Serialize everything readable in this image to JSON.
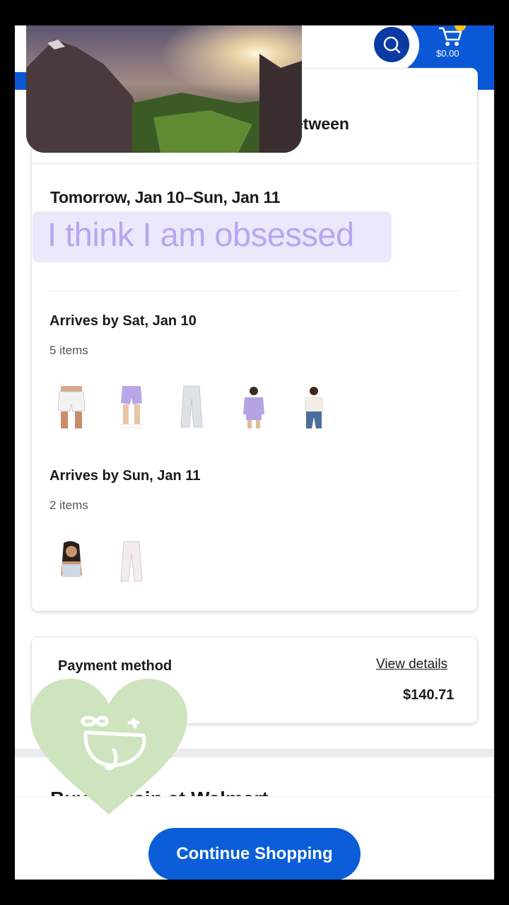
{
  "header": {
    "cart_total": "$0.00",
    "search_icon": "search-icon",
    "cart_icon": "cart-icon",
    "brand_color": "#0b5ed7"
  },
  "delivery": {
    "heading_partial": "etween",
    "date_range": "Tomorrow, Jan 10–Sun, Jan 11",
    "groups": [
      {
        "title": "Arrives by Sat, Jan 10",
        "count": "5 items"
      },
      {
        "title": "Arrives by Sun, Jan 11",
        "count": "2 items"
      }
    ]
  },
  "overlay": {
    "caption": "I think I am obsessed"
  },
  "payment": {
    "label": "Payment method",
    "view_details": "View details",
    "total": "$140.71"
  },
  "more_heading": "Buy it again at Walmart",
  "cta": {
    "label": "Continue Shopping"
  }
}
